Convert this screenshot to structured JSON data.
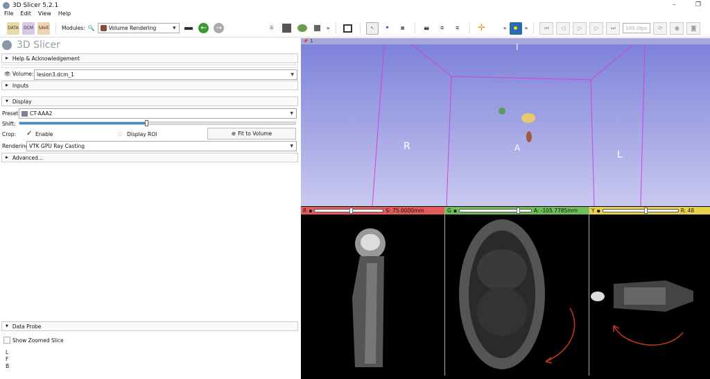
{
  "window": {
    "title": "3D Slicer 5.2.1",
    "minimize": "–",
    "restore": "❐"
  },
  "menu": [
    "File",
    "Edit",
    "View",
    "Help"
  ],
  "toolbar": {
    "data_label": "DATA",
    "dcm_label": "DCM",
    "save_label": "SAVE",
    "modules_label": "Modules:",
    "module_selected": "Volume Rendering",
    "fps": "100.0fps",
    "more": "»"
  },
  "panel": {
    "logo_text": "3D Slicer",
    "help_section": "Help & Acknowledgement",
    "volume_label": "Volume:",
    "volume_value": "lesion3.dcm_1",
    "inputs_section": "Inputs",
    "display_section": "Display",
    "preset_label": "Preset:",
    "preset_value": "CT-AAA2",
    "shift_label": "Shift:",
    "shift_fraction": 0.46,
    "crop_label": "Crop:",
    "enable_label": "Enable",
    "enable_checked": true,
    "display_roi_label": "Display ROI",
    "fit_button": "Fit to Volume",
    "rendering_label": "Rendering:",
    "rendering_value": "VTK GPU Ray Casting",
    "advanced_section": "Advanced...",
    "data_probe_section": "Data Probe",
    "show_zoomed_label": "Show Zoomed Slice",
    "probe_rows": [
      "L",
      "F",
      "B"
    ]
  },
  "view3d": {
    "index": "1",
    "labels": {
      "top": "I",
      "left": "R",
      "center": "A",
      "right": "L"
    },
    "colors": {
      "bg_top": "#7d82d9",
      "bg_bottom": "#c9c9ef",
      "box": "#d040e0"
    }
  },
  "slices": [
    {
      "name": "R",
      "offset": "S: 75.0000mm",
      "color": "#e45b5b",
      "slider": 0.53
    },
    {
      "name": "G",
      "offset": "A: -105.7785mm",
      "color": "#6fbf58",
      "slider": 0.82
    },
    {
      "name": "Y",
      "offset": "R: 48",
      "color": "#e8d24d",
      "slider": 0.57
    }
  ]
}
